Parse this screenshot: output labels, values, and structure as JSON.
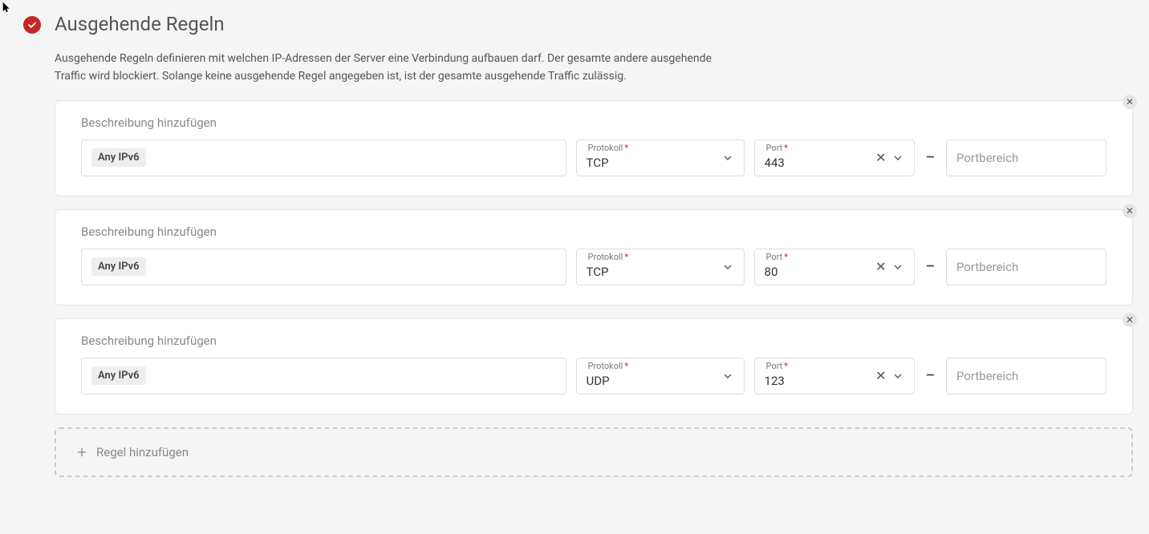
{
  "section": {
    "title": "Ausgehende Regeln",
    "description": "Ausgehende Regeln definieren mit welchen IP-Adressen der Server eine Verbindung aufbauen darf. Der gesamte andere ausgehende Traffic wird blockiert. Solange keine ausgehende Regel angegeben ist, ist der gesamte ausgehende Traffic zulässig."
  },
  "labels": {
    "description_placeholder": "Beschreibung hinzufügen",
    "protocol": "Protokoll",
    "port": "Port",
    "port_range_placeholder": "Portbereich",
    "add_rule": "Regel hinzufügen"
  },
  "rules": [
    {
      "source_tag": "Any IPv6",
      "protocol": "TCP",
      "port": "443"
    },
    {
      "source_tag": "Any IPv6",
      "protocol": "TCP",
      "port": "80"
    },
    {
      "source_tag": "Any IPv6",
      "protocol": "UDP",
      "port": "123"
    }
  ]
}
